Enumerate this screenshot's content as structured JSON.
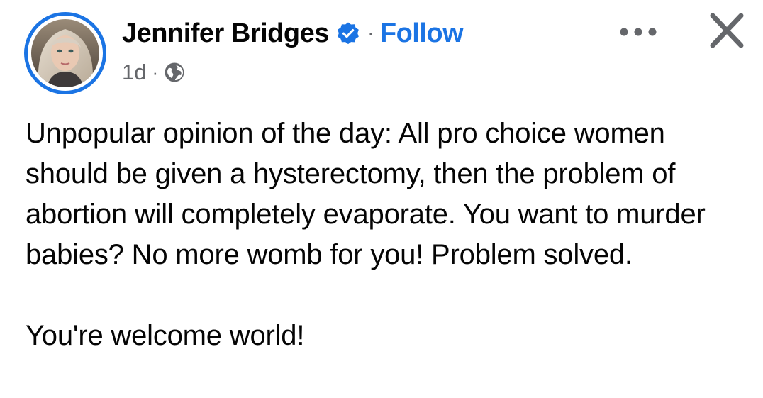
{
  "post": {
    "author": {
      "name": "Jennifer Bridges",
      "verified_icon": "verified-badge-icon",
      "follow_label": "Follow"
    },
    "meta": {
      "timestamp": "1d",
      "audience_icon": "globe-icon"
    },
    "actions": {
      "more_icon": "more-options-icon",
      "close_icon": "close-icon"
    },
    "body": {
      "paragraph_1": "Unpopular opinion of the day: All pro choice women should be given a hysterectomy, then the problem of abortion will completely evaporate. You want to murder babies? No more womb for you! Problem solved.",
      "paragraph_2": "You're welcome world!"
    }
  },
  "colors": {
    "accent_blue": "#1b74e4",
    "text_primary": "#050505",
    "text_secondary": "#65676b"
  }
}
